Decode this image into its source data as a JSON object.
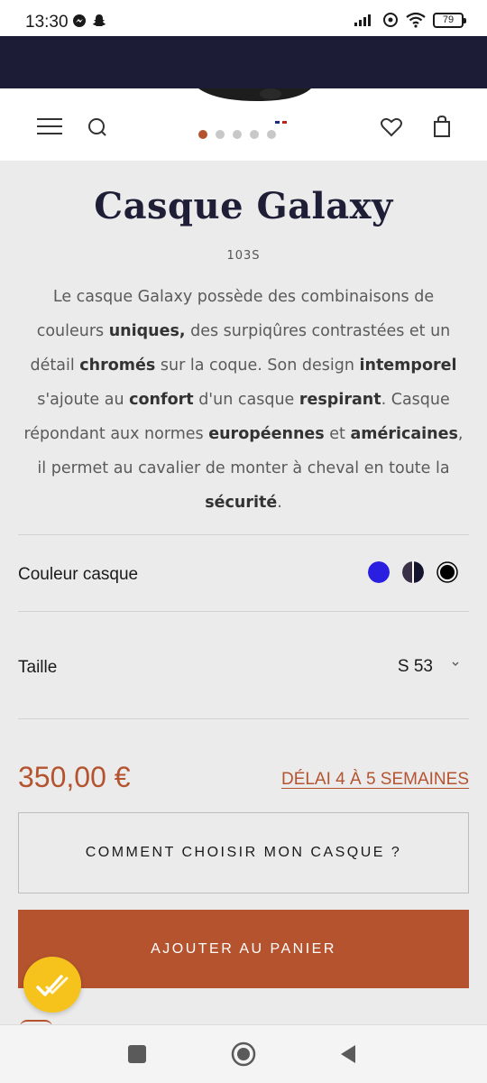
{
  "status_bar": {
    "time": "13:30",
    "battery": "79"
  },
  "header": {
    "carousel_total": 5,
    "carousel_active": 1
  },
  "product": {
    "title": "Casque Galaxy",
    "reference": "103S",
    "description_parts": [
      {
        "t": "Le casque Galaxy possède des combinaisons de couleurs ",
        "b": false
      },
      {
        "t": "uniques,",
        "b": true
      },
      {
        "t": " des surpiqûres contrastées et un détail ",
        "b": false
      },
      {
        "t": "chromés",
        "b": true
      },
      {
        "t": " sur la coque. Son design ",
        "b": false
      },
      {
        "t": "intemporel",
        "b": true
      },
      {
        "t": " s'ajoute au ",
        "b": false
      },
      {
        "t": "confort",
        "b": true
      },
      {
        "t": " d'un casque ",
        "b": false
      },
      {
        "t": "respirant",
        "b": true
      },
      {
        "t": ". Casque répondant aux normes ",
        "b": false
      },
      {
        "t": "européennes",
        "b": true
      },
      {
        "t": " et ",
        "b": false
      },
      {
        "t": "américaines",
        "b": true
      },
      {
        "t": ", il permet au cavalier de monter à cheval en toute la ",
        "b": false
      },
      {
        "t": "sécurité",
        "b": true
      },
      {
        "t": ".",
        "b": false
      }
    ]
  },
  "options": {
    "color_label": "Couleur casque",
    "colors": [
      "#2a1ee0",
      "#2a2a3a",
      "#000000"
    ],
    "size_label": "Taille",
    "size_value": "S 53"
  },
  "purchase": {
    "price": "350,00 €",
    "delay": "DÉLAI 4 À 5 SEMAINES",
    "guide_label": "COMMENT CHOISIR MON CASQUE ?",
    "cart_label": "AJOUTER AU PANIER"
  },
  "colors": {
    "accent": "#b5532f",
    "navy": "#1c1c36",
    "badge": "#f6c31c"
  }
}
